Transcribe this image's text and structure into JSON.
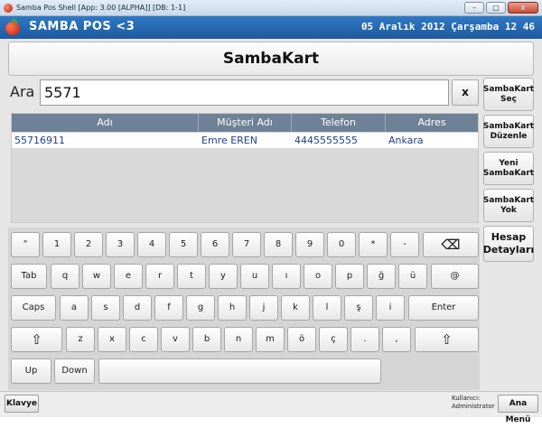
{
  "window": {
    "title": "Samba Pos Shell [App: 3.00 [ALPHA]] [DB: 1-1]",
    "minimize": "–",
    "maximize": "□",
    "close": "x"
  },
  "header": {
    "brand": "SAMBA POS <3",
    "datetime": "05 Aralık 2012 Çarşamba 12 46"
  },
  "page": {
    "title": "SambaKart"
  },
  "search": {
    "label": "Ara",
    "value": "5571",
    "clear_label": "x"
  },
  "table": {
    "columns": [
      "Adı",
      "Müşteri Adı",
      "Telefon",
      "Adres"
    ],
    "rows": [
      [
        "55716911",
        "Emre EREN",
        "4445555555",
        "Ankara"
      ]
    ]
  },
  "side_buttons": [
    "SambaKart Seç",
    "SambaKart Düzenle",
    "Yeni SambaKart",
    "SambaKart Yok",
    "Hesap Detayları"
  ],
  "keyboard": {
    "row1": [
      "\"",
      "1",
      "2",
      "3",
      "4",
      "5",
      "6",
      "7",
      "8",
      "9",
      "0",
      "*",
      "-"
    ],
    "row2": [
      "Tab",
      "q",
      "w",
      "e",
      "r",
      "t",
      "y",
      "u",
      "ı",
      "o",
      "p",
      "ğ",
      "ü",
      "@"
    ],
    "row3": [
      "Caps",
      "a",
      "s",
      "d",
      "f",
      "g",
      "h",
      "j",
      "k",
      "l",
      "ş",
      "i",
      "Enter"
    ],
    "row4": [
      "z",
      "x",
      "c",
      "v",
      "b",
      "n",
      "m",
      "ö",
      "ç",
      ".",
      ","
    ],
    "row5": [
      "Up",
      "Down"
    ],
    "shift_glyph": "⇧",
    "backspace_glyph": "⌫"
  },
  "bottom": {
    "keyboard_button": "Klavye",
    "user_label": "Kullanıcı:",
    "user_name": "Administrator",
    "main_menu_button": "Ana Menü"
  }
}
